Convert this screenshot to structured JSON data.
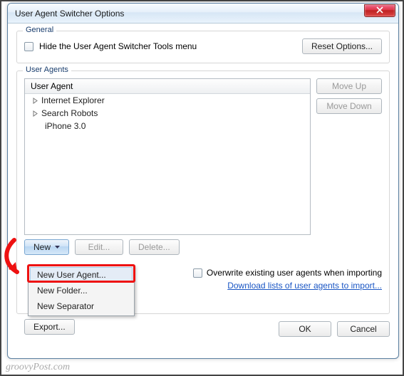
{
  "window": {
    "title": "User Agent Switcher Options"
  },
  "general": {
    "legend": "General",
    "hide_checkbox_checked": false,
    "hide_label": "Hide the User Agent Switcher Tools menu",
    "reset_button": "Reset Options..."
  },
  "user_agents": {
    "legend": "User Agents",
    "column_header": "User Agent",
    "items": [
      {
        "label": "Internet Explorer",
        "expandable": true
      },
      {
        "label": "Search Robots",
        "expandable": true
      },
      {
        "label": "iPhone 3.0",
        "expandable": false
      }
    ],
    "move_up": "Move Up",
    "move_down": "Move Down",
    "new_button": "New",
    "edit_button": "Edit...",
    "delete_button": "Delete...",
    "export_button": "Export...",
    "overwrite_checkbox_checked": false,
    "overwrite_label": "Overwrite existing user agents when importing",
    "download_link": "Download lists of user agents to import..."
  },
  "dropdown": {
    "items": [
      "New User Agent...",
      "New Folder...",
      "New Separator"
    ]
  },
  "buttons": {
    "ok": "OK",
    "cancel": "Cancel"
  },
  "watermark": "groovyPost.com"
}
